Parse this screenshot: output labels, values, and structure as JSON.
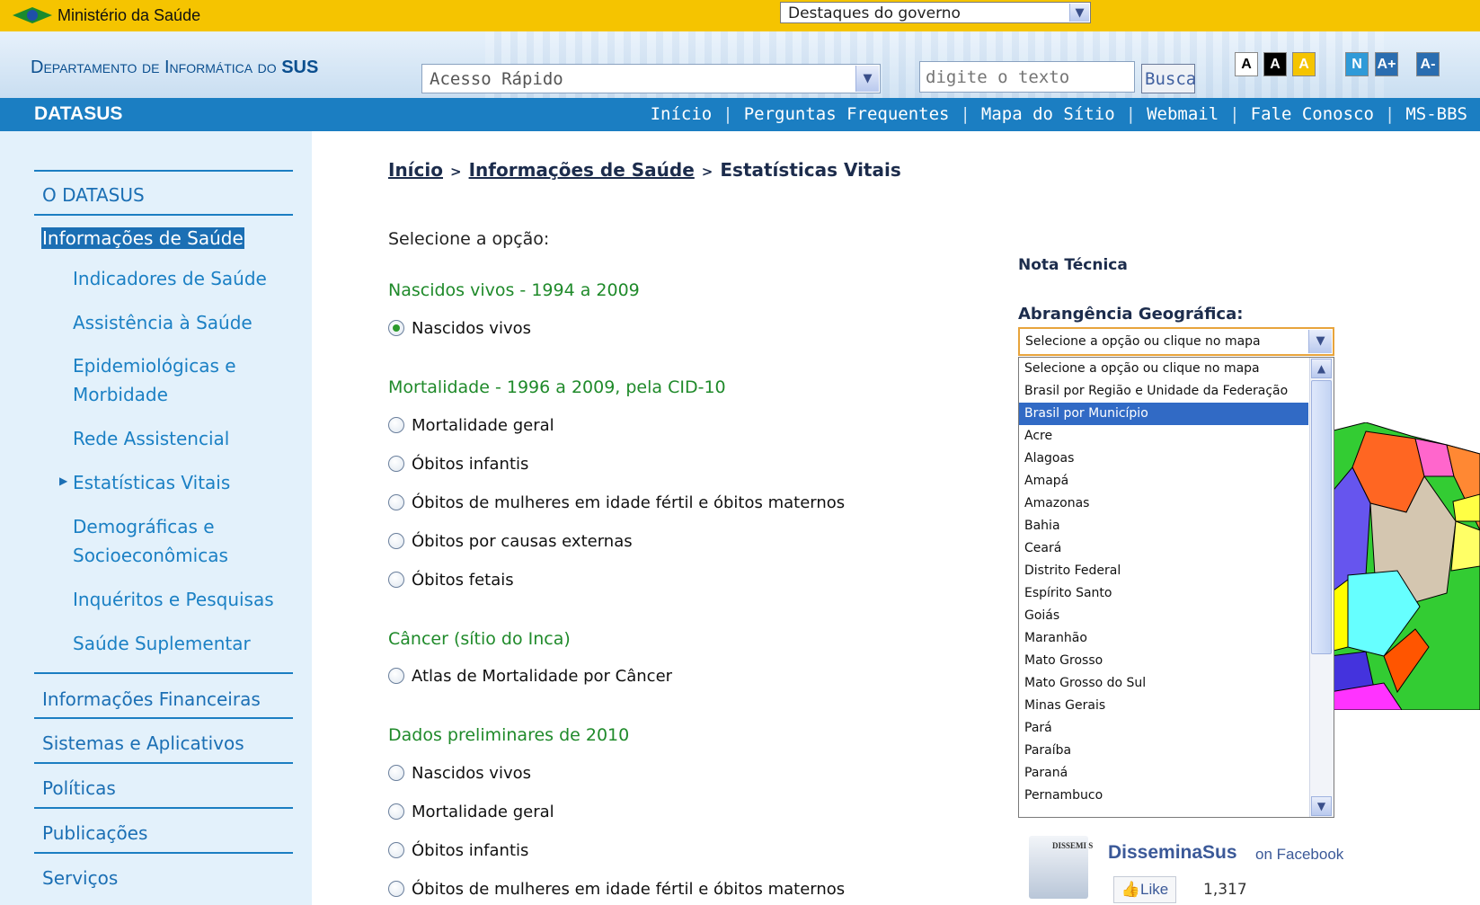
{
  "gov_bar": {
    "title": "Ministério da Saúde",
    "destaques_select": "Destaques do governo"
  },
  "header": {
    "dept_small": "Departamento de Informática do",
    "dept_strong": "SUS",
    "quick_access": "Acesso Rápido",
    "search_placeholder": "digite o texto",
    "search_button": "Busca",
    "accessibility": [
      "A",
      "A",
      "A",
      "N",
      "A+",
      "A-"
    ]
  },
  "nav": {
    "brand": "DATASUS",
    "links": [
      "Início",
      "Perguntas Frequentes",
      "Mapa do Sítio",
      "Webmail",
      "Fale Conosco",
      "MS-BBS"
    ]
  },
  "sidebar": {
    "o_datasus": "O DATASUS",
    "informacoes_saude": "Informações de Saúde",
    "sub": [
      "Indicadores de Saúde",
      "Assistência à Saúde",
      "Epidemiológicas e",
      "Morbidade",
      "Rede Assistencial",
      "Estatísticas Vitais",
      "Demográficas e",
      "Socioeconômicas",
      "Inquéritos e Pesquisas",
      "Saúde Suplementar"
    ],
    "top": [
      "Informações Financeiras",
      "Sistemas e Aplicativos",
      "Políticas",
      "Publicações",
      "Serviços"
    ]
  },
  "breadcrumb": {
    "home": "Início",
    "section": "Informações de Saúde",
    "current": "Estatísticas Vitais"
  },
  "main": {
    "prompt": "Selecione a opção:",
    "sections": [
      {
        "title": "Nascidos vivos - 1994 a 2009",
        "options": [
          "Nascidos vivos"
        ]
      },
      {
        "title": "Mortalidade - 1996 a 2009, pela CID-10",
        "options": [
          "Mortalidade geral",
          "Óbitos infantis",
          "Óbitos de mulheres em idade fértil e óbitos maternos",
          "Óbitos por causas externas",
          "Óbitos fetais"
        ]
      },
      {
        "title": "Câncer (sítio do Inca)",
        "options": [
          "Atlas de Mortalidade por Câncer"
        ]
      },
      {
        "title": "Dados preliminares de 2010",
        "options": [
          "Nascidos vivos",
          "Mortalidade geral",
          "Óbitos infantis",
          "Óbitos de mulheres em idade fértil e óbitos maternos"
        ]
      }
    ]
  },
  "right": {
    "nota_tecnica": "Nota Técnica",
    "geo_label": "Abrangência Geográfica:",
    "geo_selected": "Selecione a opção ou clique no mapa",
    "geo_options": [
      "Selecione a opção ou clique no mapa",
      "Brasil por Região e Unidade da Federação",
      "Brasil por Município",
      "Acre",
      "Alagoas",
      "Amapá",
      "Amazonas",
      "Bahia",
      "Ceará",
      "Distrito Federal",
      "Espírito Santo",
      "Goiás",
      "Maranhão",
      "Mato Grosso",
      "Mato Grosso do Sul",
      "Minas Gerais",
      "Pará",
      "Paraíba",
      "Paraná",
      "Pernambuco"
    ],
    "geo_highlighted": "Brasil por Município"
  },
  "facebook": {
    "logo_text": "DISSEMI S",
    "page_name": "DisseminaSus",
    "on_facebook": "on Facebook",
    "like": "Like",
    "count": "1,317"
  },
  "colors": {
    "gov_yellow": "#f5c400",
    "nav_blue": "#1b7ec2",
    "section_green": "#1f8a2a",
    "highlight": "#316ac5"
  }
}
